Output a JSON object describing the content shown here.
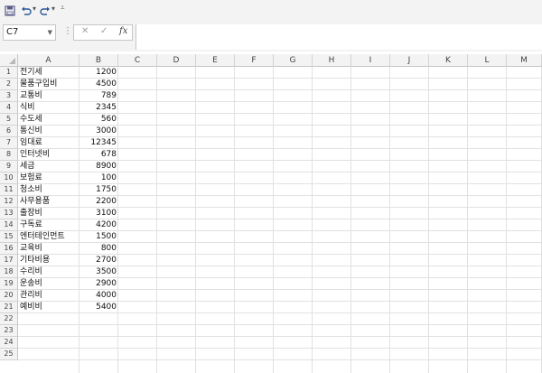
{
  "toolbar": {
    "icons": [
      "save-icon",
      "undo-icon",
      "redo-icon",
      "customize-quick-access-icon"
    ]
  },
  "formula_bar": {
    "name_box": "C7",
    "cancel_glyph": "✕",
    "enter_glyph": "✓",
    "fx_glyph": "fx",
    "formula_value": ""
  },
  "columns": [
    "A",
    "B",
    "C",
    "D",
    "E",
    "F",
    "G",
    "H",
    "I",
    "J",
    "K",
    "L",
    "M"
  ],
  "rows": [
    {
      "num": "1",
      "a": "전기세",
      "b": "1200"
    },
    {
      "num": "2",
      "a": "물품구입비",
      "b": "4500"
    },
    {
      "num": "3",
      "a": "교통비",
      "b": "789"
    },
    {
      "num": "4",
      "a": "식비",
      "b": "2345"
    },
    {
      "num": "5",
      "a": "수도세",
      "b": "560"
    },
    {
      "num": "6",
      "a": "통신비",
      "b": "3000"
    },
    {
      "num": "7",
      "a": "임대료",
      "b": "12345"
    },
    {
      "num": "8",
      "a": "인터넷비",
      "b": "678"
    },
    {
      "num": "9",
      "a": "세금",
      "b": "8900"
    },
    {
      "num": "10",
      "a": "보험료",
      "b": "100"
    },
    {
      "num": "11",
      "a": "청소비",
      "b": "1750"
    },
    {
      "num": "12",
      "a": "사무용품",
      "b": "2200"
    },
    {
      "num": "13",
      "a": "출장비",
      "b": "3100"
    },
    {
      "num": "14",
      "a": "구독료",
      "b": "4200"
    },
    {
      "num": "15",
      "a": "엔터테인먼트",
      "b": "1500"
    },
    {
      "num": "16",
      "a": "교육비",
      "b": "800"
    },
    {
      "num": "17",
      "a": "기타비용",
      "b": "2700"
    },
    {
      "num": "18",
      "a": "수리비",
      "b": "3500"
    },
    {
      "num": "19",
      "a": "운송비",
      "b": "2900"
    },
    {
      "num": "20",
      "a": "관리비",
      "b": "4000"
    },
    {
      "num": "21",
      "a": "예비비",
      "b": "5400"
    },
    {
      "num": "22",
      "a": "",
      "b": ""
    },
    {
      "num": "23",
      "a": "",
      "b": ""
    },
    {
      "num": "24",
      "a": "",
      "b": ""
    },
    {
      "num": "25",
      "a": "",
      "b": ""
    }
  ],
  "colors": {
    "accent": "#217346",
    "header_bg": "#f3f3f3",
    "gridline": "#e1e1e1"
  }
}
